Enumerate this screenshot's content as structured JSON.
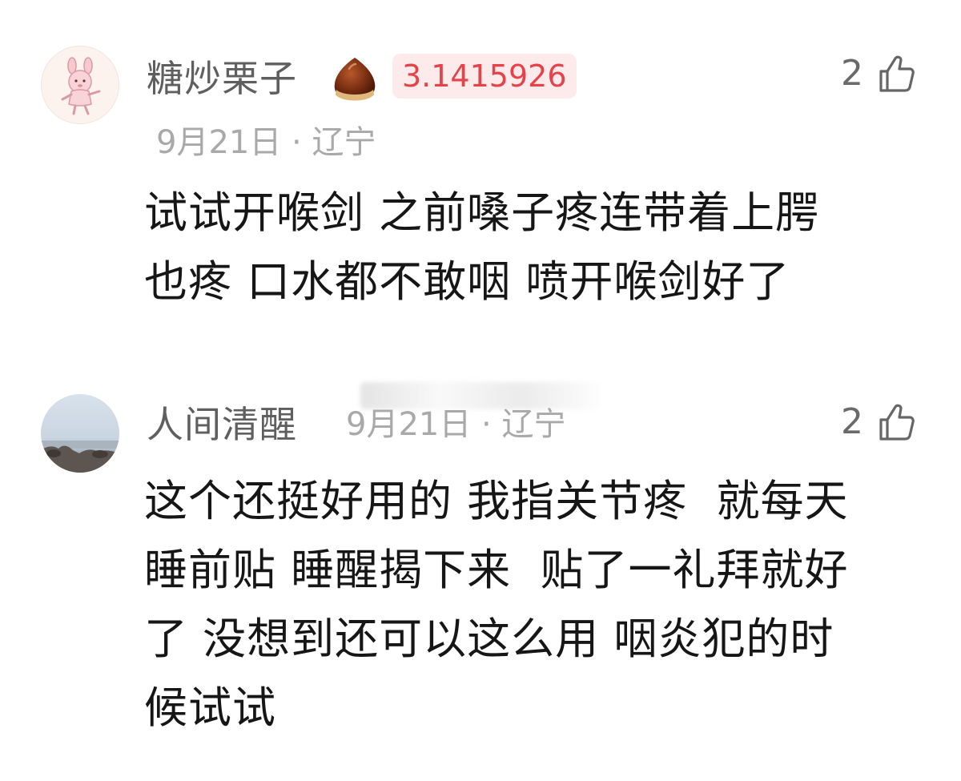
{
  "comments": [
    {
      "username": "糖炒栗子",
      "badge": "3.1415926",
      "meta": "9月21日 · 辽宁",
      "likes": "2",
      "text": "试试开喉剑 之前嗓子疼连带着上腭\n也疼 口水都不敢咽 喷开喉剑好了",
      "avatar_icon": "pink-bunny-avatar",
      "decoration_icon": "chestnut-icon"
    },
    {
      "username": "人间清醒",
      "meta": "9月21日 · 辽宁",
      "likes": "2",
      "text": "这个还挺好用的 我指关节疼  就每天\n睡前贴 睡醒揭下来  贴了一礼拜就好\n了 没想到还可以这么用 咽炎犯的时\n候试试",
      "avatar_icon": "seaside-photo-avatar"
    }
  ],
  "colors": {
    "badge_text": "#e5424a",
    "badge_bg": "#fdeaea",
    "username": "#5f5f5f",
    "meta": "#a9a9a9",
    "body_text": "#161616"
  }
}
